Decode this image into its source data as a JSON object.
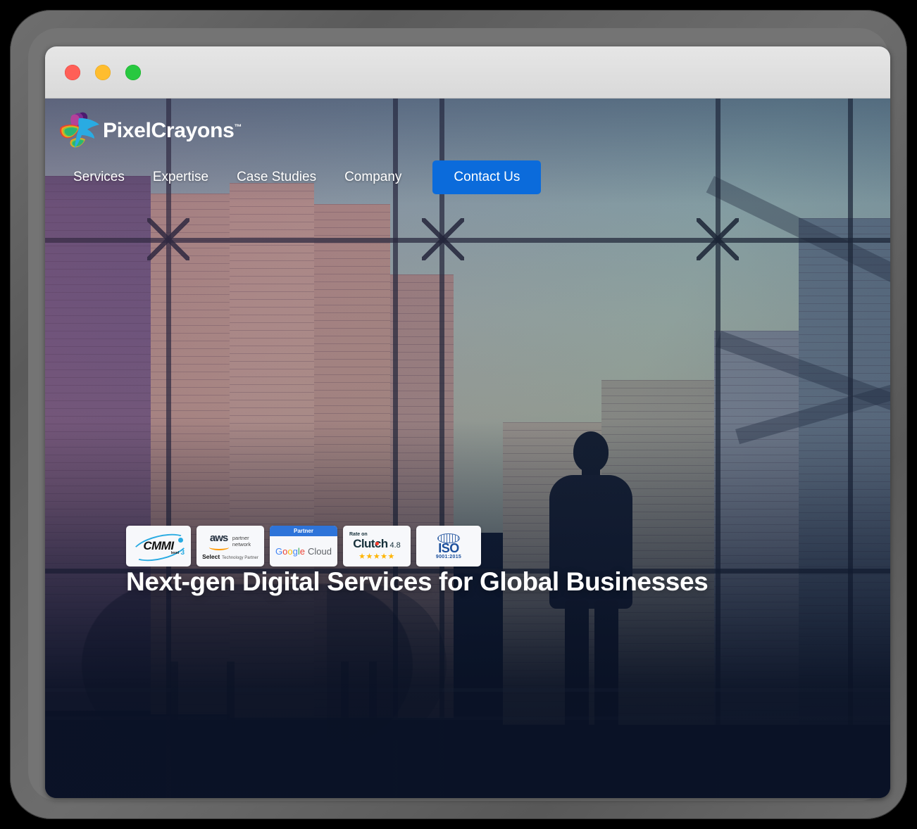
{
  "window": {
    "traffic_lights": [
      {
        "name": "close",
        "color": "#ff5f57"
      },
      {
        "name": "minimize",
        "color": "#ffbd2e"
      },
      {
        "name": "maximize",
        "color": "#28c840"
      }
    ]
  },
  "site": {
    "brand": {
      "name": "PixelCrayons",
      "trademark": "™",
      "logo_icon": "hummingbird-logo"
    },
    "nav": {
      "items": [
        {
          "label": "Services"
        },
        {
          "label": "Expertise"
        },
        {
          "label": "Case Studies"
        },
        {
          "label": "Company"
        }
      ],
      "cta": {
        "label": "Contact Us",
        "color": "#0b6bdb"
      }
    },
    "hero": {
      "headline": "Next-gen Digital Services for Global Businesses",
      "background": "city-skyline-through-window-with-businessman-silhouette"
    },
    "badges": [
      {
        "id": "cmmi",
        "name": "CMMI Level 3",
        "title": "CMMI",
        "level_label": "level",
        "level_value": "3"
      },
      {
        "id": "aws",
        "name": "AWS Partner Network",
        "logo": "aws",
        "line1": "partner",
        "line2": "network",
        "tier": "Select",
        "tier_sub": "Technology Partner"
      },
      {
        "id": "google-cloud",
        "name": "Google Cloud Partner",
        "header": "Partner",
        "brand_g": "G",
        "brand_o1": "o",
        "brand_o2": "o",
        "brand_g2": "g",
        "brand_l": "l",
        "brand_e": "e",
        "product": "Cloud"
      },
      {
        "id": "clutch",
        "name": "Clutch Rating",
        "prefix": "Rate on",
        "title": "Clutch",
        "score": "4.8",
        "stars": "★★★★★"
      },
      {
        "id": "iso",
        "name": "ISO 9001:2015",
        "title": "ISO",
        "standard": "9001:2015"
      }
    ]
  }
}
